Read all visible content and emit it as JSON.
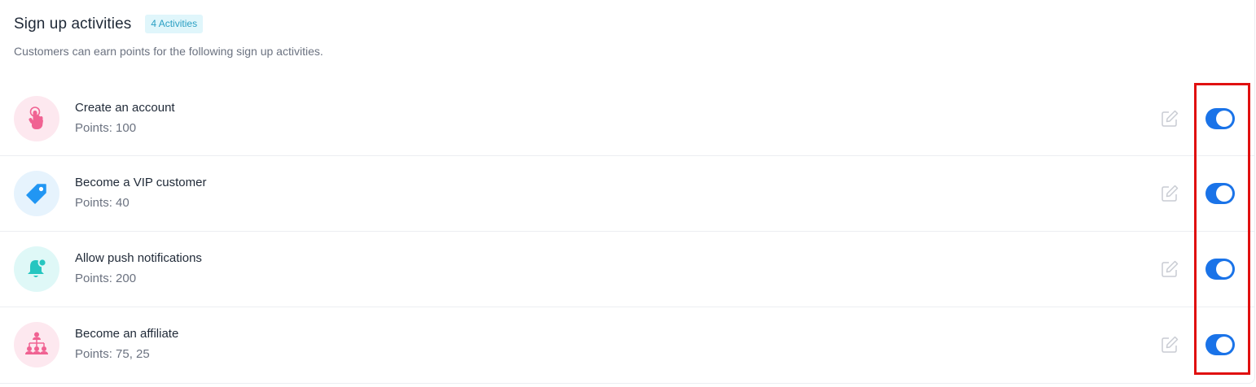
{
  "section": {
    "title": "Sign up activities",
    "count_badge": "4 Activities",
    "subtitle": "Customers can earn points for the following sign up activities."
  },
  "activities": [
    {
      "title": "Create an account",
      "points": "Points: 100",
      "icon": "pointer-hand-icon",
      "icon_bg": "#fde8ef",
      "icon_color": "#f06292",
      "enabled": true
    },
    {
      "title": "Become a VIP customer",
      "points": "Points: 40",
      "icon": "tag-icon",
      "icon_bg": "#e6f3fd",
      "icon_color": "#2196f3",
      "enabled": true
    },
    {
      "title": "Allow push notifications",
      "points": "Points: 200",
      "icon": "bell-icon",
      "icon_bg": "#dff8f7",
      "icon_color": "#26c6c0",
      "enabled": true
    },
    {
      "title": "Become an affiliate",
      "points": "Points: 75, 25",
      "icon": "network-icon",
      "icon_bg": "#fde8ef",
      "icon_color": "#f06292",
      "enabled": true
    }
  ],
  "colors": {
    "toggle_on": "#1a73e8",
    "highlight": "#e01010",
    "badge_bg": "#e0f6fb",
    "badge_text": "#2a9fc3"
  }
}
